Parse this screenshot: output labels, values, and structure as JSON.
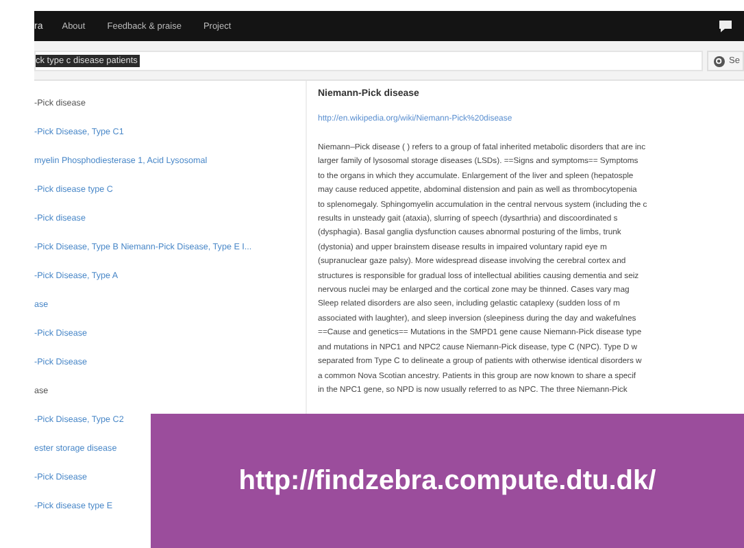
{
  "navbar": {
    "brand": "ra",
    "links": [
      "About",
      "Feedback & praise",
      "Project"
    ]
  },
  "search": {
    "value": "ck type c disease patients",
    "button": "Se"
  },
  "results": [
    {
      "label": "-Pick disease",
      "kind": "plain"
    },
    {
      "label": "-Pick Disease, Type C1",
      "kind": "link"
    },
    {
      "label": "myelin Phosphodiesterase 1, Acid Lysosomal",
      "kind": "link"
    },
    {
      "label": "-Pick disease type C",
      "kind": "link"
    },
    {
      "label": "-Pick disease",
      "kind": "link"
    },
    {
      "label": "-Pick Disease, Type B Niemann-Pick Disease, Type E I...",
      "kind": "link"
    },
    {
      "label": "-Pick Disease, Type A",
      "kind": "link"
    },
    {
      "label": "ase",
      "kind": "link"
    },
    {
      "label": "-Pick Disease",
      "kind": "link"
    },
    {
      "label": "-Pick Disease",
      "kind": "link"
    },
    {
      "label": "ase",
      "kind": "plain"
    },
    {
      "label": "-Pick Disease, Type C2",
      "kind": "link"
    },
    {
      "label": "ester storage disease",
      "kind": "link"
    },
    {
      "label": "-Pick Disease",
      "kind": "link"
    },
    {
      "label": "-Pick disease type E",
      "kind": "link"
    }
  ],
  "article": {
    "title": "Niemann-Pick disease",
    "url": "http://en.wikipedia.org/wiki/Niemann-Pick%20disease",
    "lines": [
      "Niemann–Pick disease ( ) refers to a group of fatal inherited metabolic disorders that are inc",
      "larger family of lysosomal storage diseases (LSDs). ==Signs and symptoms== Symptoms",
      "to the organs in which they accumulate. Enlargement of the liver and spleen (hepatosple",
      "may cause reduced appetite, abdominal distension and pain as well as thrombocytopenia",
      "to splenomegaly. Sphingomyelin accumulation in the central nervous system (including the c",
      "results in unsteady gait (ataxia), slurring of speech (dysarthria) and discoordinated s",
      "(dysphagia). Basal ganglia dysfunction causes abnormal posturing of the limbs, trunk",
      "(dystonia) and upper brainstem disease results in impaired voluntary rapid eye m",
      "(supranuclear gaze palsy). More widespread disease involving the cerebral cortex and",
      "structures is responsible for gradual loss of intellectual abilities causing dementia and seiz",
      "nervous nuclei may be enlarged and the cortical zone may be thinned. Cases vary mag",
      "Sleep related disorders are also seen, including gelastic cataplexy (sudden loss of m",
      "associated with laughter), and sleep inversion (sleepiness during the day and wakefulnes",
      "==Cause and genetics== Mutations in the SMPD1 gene cause Niemann-Pick disease type",
      "and mutations in NPC1 and NPC2 cause Niemann-Pick disease, type C (NPC). Type D w",
      "separated from Type C to delineate a group of patients with otherwise identical disorders w",
      "a common Nova Scotian ancestry. Patients in this group are now known to share a specif",
      "in the NPC1 gene, so NPD is now usually referred to as NPC. The three Niemann-Pick"
    ]
  },
  "banner": {
    "text": "http://findzebra.compute.dtu.dk/"
  }
}
